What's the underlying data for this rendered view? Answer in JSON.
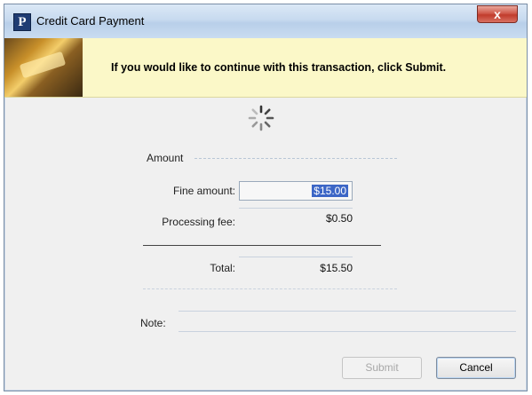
{
  "window": {
    "title": "Credit Card Payment",
    "close_label": "x",
    "app_icon_letter": "P"
  },
  "banner": {
    "message": "If you would like to continue with this transaction, click Submit."
  },
  "payment": {
    "section_label": "Amount",
    "fine_amount_label": "Fine amount:",
    "fine_amount_value": "$15.00",
    "processing_fee_label": "Processing fee:",
    "processing_fee_value": "$0.50",
    "total_label": "Total:",
    "total_value": "$15.50",
    "note_label": "Note:"
  },
  "buttons": {
    "submit_label": "Submit",
    "cancel_label": "Cancel"
  },
  "colors": {
    "selection": "#3c66c6",
    "banner_bg": "#fbf8c8",
    "close_red": "#c13c2c"
  },
  "icons": {
    "app": "p-logo-icon",
    "loading": "loading-spinner-icon",
    "close": "close-icon"
  }
}
